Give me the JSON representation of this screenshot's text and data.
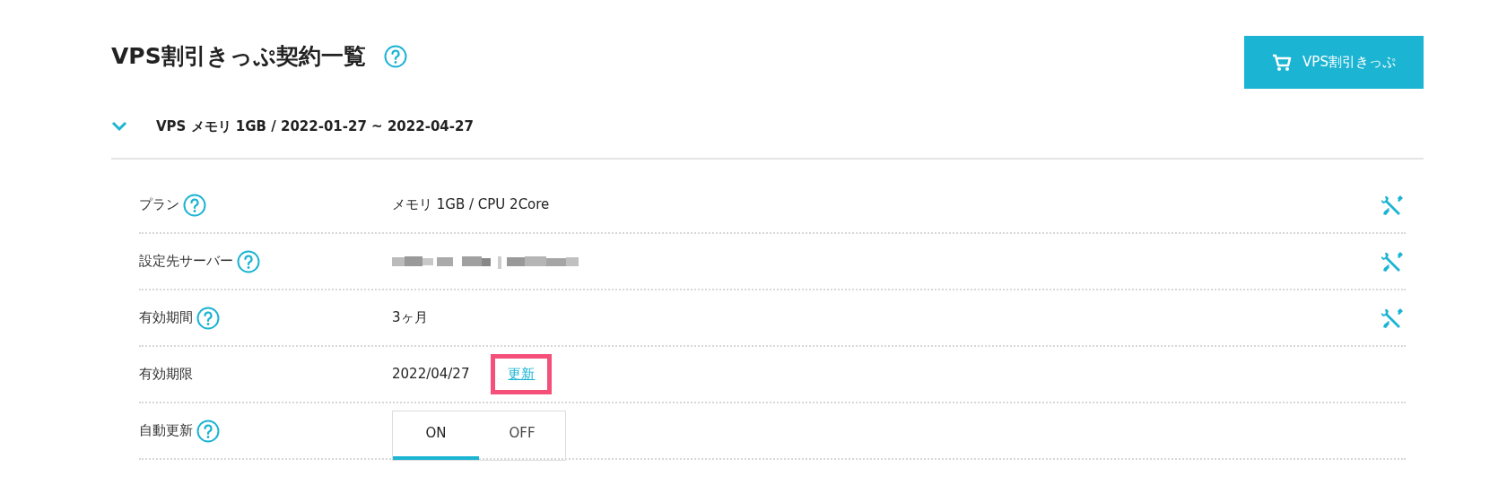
{
  "title": "VPS割引きっぷ契約一覧",
  "buy_button": "VPS割引きっぷ",
  "contract": {
    "expanded": true,
    "heading": "VPS メモリ 1GB / 2022-01-27 ~ 2022-04-27"
  },
  "rows": [
    {
      "kind": "text",
      "label": "プラン",
      "help": true,
      "value": "メモリ 1GB / CPU 2Core",
      "editable": true
    },
    {
      "kind": "redacted",
      "label": "設定先サーバー",
      "help": true,
      "editable": true
    },
    {
      "kind": "text",
      "label": "有効期間",
      "help": true,
      "value": "3ヶ月",
      "editable": true
    },
    {
      "kind": "link",
      "label": "有効期限",
      "help": false,
      "value": "2022/04/27",
      "link": "更新",
      "highlighted": true,
      "editable": false
    },
    {
      "kind": "toggle",
      "label": "自動更新",
      "help": true,
      "options": [
        {
          "label": "ON",
          "selected": true
        },
        {
          "label": "OFF",
          "selected": false
        }
      ],
      "editable": false
    }
  ]
}
